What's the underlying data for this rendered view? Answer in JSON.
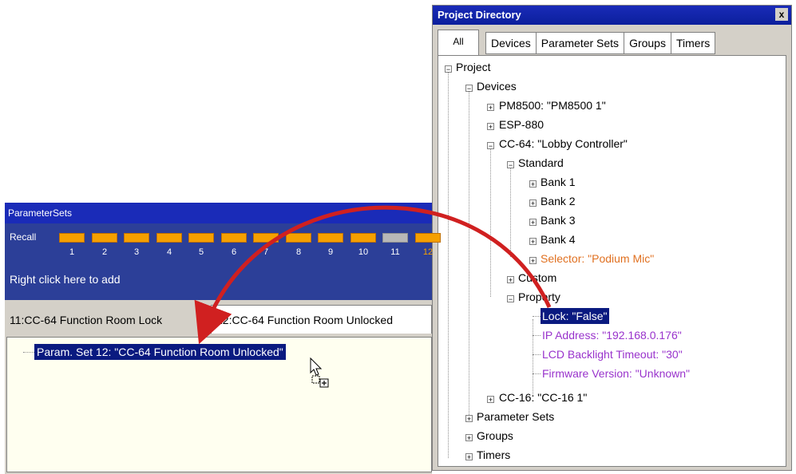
{
  "project_directory": {
    "title": "Project Directory",
    "close": "x",
    "tabs": [
      "All",
      "Devices",
      "Parameter Sets",
      "Groups",
      "Timers"
    ],
    "tree": {
      "project": "Project",
      "devices": "Devices",
      "pm8500": "PM8500: \"PM8500 1\"",
      "esp880": "ESP-880",
      "cc64": "CC-64: \"Lobby Controller\"",
      "standard": "Standard",
      "bank1": "Bank 1",
      "bank2": "Bank 2",
      "bank3": "Bank 3",
      "bank4": "Bank 4",
      "selector": "Selector: \"Podium Mic\"",
      "custom": "Custom",
      "property": "Property",
      "lock": "Lock: \"False\"",
      "ip": "IP Address: \"192.168.0.176\"",
      "lcd": "LCD Backlight Timeout: \"30\"",
      "firmware": "Firmware Version: \"Unknown\"",
      "cc16": "CC-16: \"CC-16 1\"",
      "parameter_sets": "Parameter Sets",
      "groups": "Groups",
      "timers": "Timers"
    }
  },
  "parameter_sets": {
    "title": "ParameterSets",
    "recall_label": "Recall",
    "recall_numbers": [
      "1",
      "2",
      "3",
      "4",
      "5",
      "6",
      "7",
      "8",
      "9",
      "10",
      "11",
      "12"
    ],
    "add_hint": "Right click here to add",
    "tabs": [
      "11:CC-64 Function Room Lock",
      "12:CC-64 Function Room Unlocked"
    ],
    "item": "Param. Set 12: \"CC-64 Function Room Unlocked\""
  },
  "colors": {
    "recall_on": "#f5a000",
    "recall_off": "#b8b8b8",
    "arrow": "#d02020"
  }
}
